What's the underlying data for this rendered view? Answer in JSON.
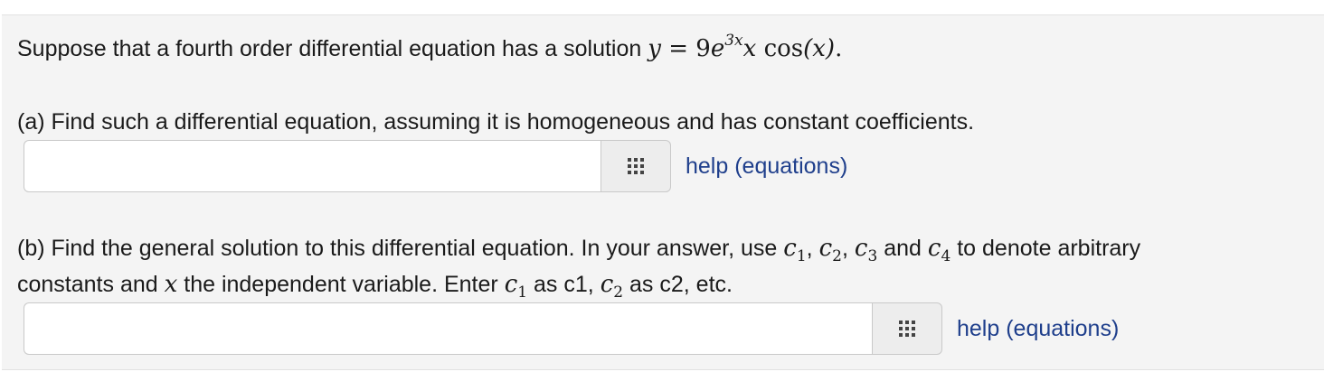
{
  "problem": {
    "intro_text": "Suppose that a fourth order differential equation has a solution",
    "solution_expr": {
      "lhs": "y",
      "eq": "=",
      "coef": "9",
      "base": "e",
      "exponent": "3x",
      "mult": "x",
      "func": "cos",
      "arg": "(x)",
      "end": "."
    },
    "part_a": {
      "prompt": "(a) Find such a differential equation, assuming it is homogeneous and has constant coefficients.",
      "input_value": "",
      "help_label": "help (equations)"
    },
    "part_b": {
      "prompt_1": "(b) Find the general solution to this differential equation. In your answer, use",
      "c_letter": "c",
      "c1_sub": "1",
      "c2_sub": "2",
      "c3_sub": "3",
      "c4_sub": "4",
      "comma": ",",
      "and_word": "and",
      "prompt_1_end": "to denote arbitrary",
      "prompt_2_start": "constants and",
      "var_x": "x",
      "prompt_2_mid": "the independent variable. Enter",
      "as_c1": "as c1,",
      "as_c2": "as c2, etc.",
      "input_value": "",
      "help_label": "help (equations)"
    }
  },
  "icons": {
    "palette": "equation-palette-grid-icon"
  },
  "colors": {
    "panel_bg": "#f4f4f4",
    "link": "#1f3f8c",
    "icon": "#444444"
  }
}
